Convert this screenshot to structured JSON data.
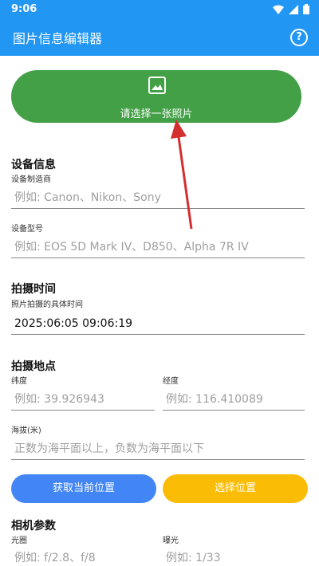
{
  "status": {
    "time": "9:06"
  },
  "app": {
    "title": "图片信息编辑器",
    "help_symbol": "?"
  },
  "pick_photo": {
    "label": "请选择一张照片",
    "icon": "image-icon"
  },
  "device": {
    "title": "设备信息",
    "maker_label": "设备制造商",
    "maker_placeholder": "例如: Canon、Nikon、Sony",
    "model_label": "设备型号",
    "model_placeholder": "例如: EOS 5D Mark IV、D850、Alpha 7R IV"
  },
  "capture_time": {
    "title": "拍摄时间",
    "label": "照片拍摄的具体时间",
    "value": "2025:06:05 09:06:19"
  },
  "location": {
    "title": "拍摄地点",
    "lat_label": "纬度",
    "lat_placeholder": "例如: 39.926943",
    "lng_label": "经度",
    "lng_placeholder": "例如: 116.410089",
    "alt_label": "海拔(米)",
    "alt_placeholder": "正数为海平面以上，负数为海平面以下",
    "get_current_label": "获取当前位置",
    "choose_label": "选择位置"
  },
  "camera": {
    "title": "相机参数",
    "aperture_label": "光圈",
    "aperture_placeholder": "例如: f/2.8、f/8",
    "exposure_label": "曝光",
    "exposure_placeholder": "例如: 1/33"
  },
  "colors": {
    "primary": "#2196f3",
    "green": "#43a047",
    "blue_btn": "#4285f4",
    "yellow_btn": "#fbbc05",
    "arrow": "#d32f2f"
  }
}
